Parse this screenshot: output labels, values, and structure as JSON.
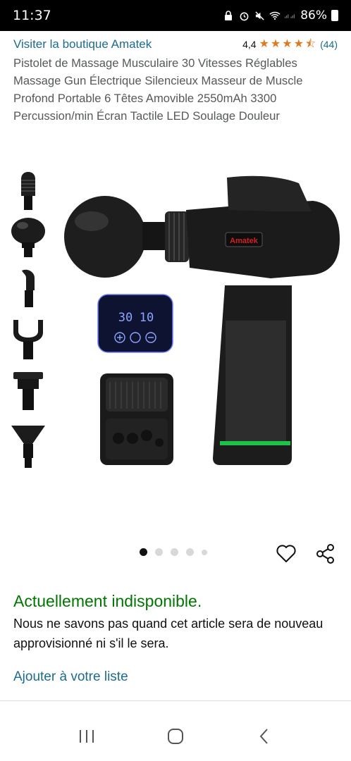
{
  "status_bar": {
    "time": "11:37",
    "battery": "86%"
  },
  "product": {
    "store_link": "Visiter la boutique Amatek",
    "rating_value": "4,4",
    "rating_count": "(44)",
    "title": "Pistolet de Massage Musculaire 30 Vitesses Réglables Massage Gun Électrique Silencieux Masseur de Muscle Profond Portable 6 Têtes Amovible 2550mAh 3300 Percussion/min Écran Tactile LED Soulage Douleur",
    "brand_label": "Amatek",
    "display_left": "30",
    "display_right": "10"
  },
  "availability": {
    "status": "Actuellement indisponible.",
    "note": "Nous ne savons pas quand cet article sera de nouveau approvisionné ni s'il le sera.",
    "add_to_list": "Ajouter à votre liste"
  },
  "icons": {
    "heart": "heart-icon",
    "share": "share-icon",
    "nav_recent": "recent-apps-icon",
    "nav_home": "home-icon",
    "nav_back": "back-icon"
  },
  "colors": {
    "link": "#1d6b8e",
    "star": "#de7921",
    "available_green": "#007600"
  }
}
